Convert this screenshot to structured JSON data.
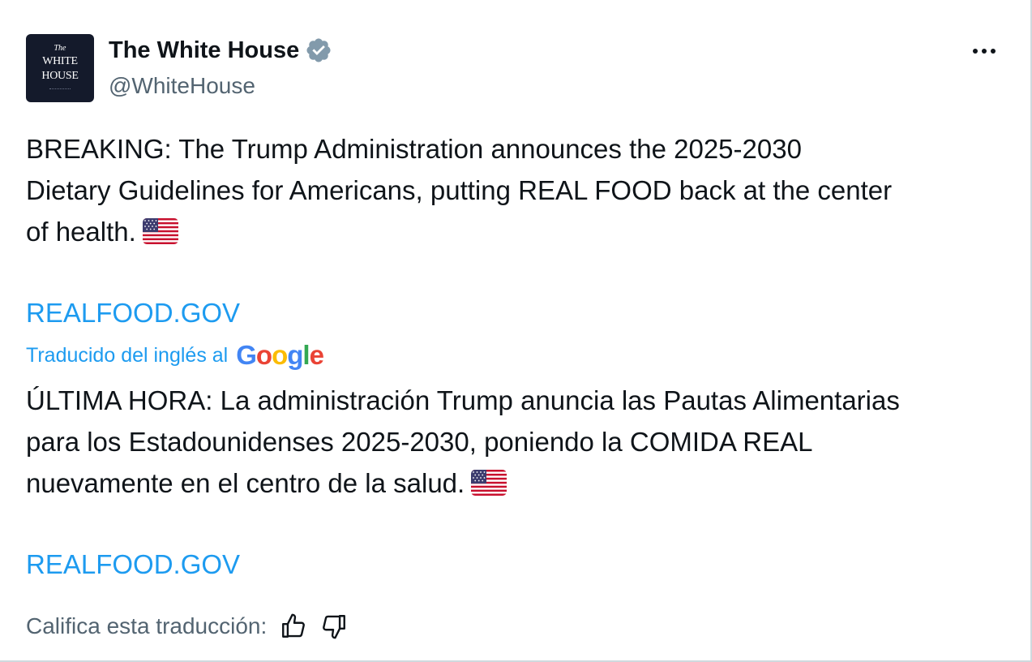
{
  "author": {
    "display_name": "The White House",
    "handle": "@WhiteHouse",
    "avatar_text": {
      "the": "The",
      "line1": "WHITE",
      "line2": "HOUSE"
    }
  },
  "post": {
    "original_lines": [
      "BREAKING: The Trump Administration announces the 2025-2030",
      "Dietary Guidelines for Americans, putting REAL FOOD back at the center",
      "of health."
    ],
    "original_link": "REALFOOD.GOV",
    "translation_label": "Traducido del inglés al",
    "translation_provider": [
      "G",
      "o",
      "o",
      "g",
      "l",
      "e"
    ],
    "translated_lines": [
      "ÚLTIMA HORA: La administración Trump anuncia las Pautas Alimentarias",
      "para los Estadounidenses 2025-2030, poniendo la COMIDA REAL",
      "nuevamente en el centro de la salud."
    ],
    "translated_link": "REALFOOD.GOV"
  },
  "rating": {
    "label": "Califica esta traducción:"
  },
  "icons": [
    "verified-badge-icon",
    "more-options-icon",
    "us-flag-icon",
    "thumbs-up-icon",
    "thumbs-down-icon"
  ],
  "colors": {
    "link": "#1d9bf0",
    "secondary_text": "#536471",
    "verified_badge": "#829aab",
    "google": [
      "#4285F4",
      "#EA4335",
      "#FBBC05",
      "#4285F4",
      "#34A853",
      "#EA4335"
    ]
  }
}
